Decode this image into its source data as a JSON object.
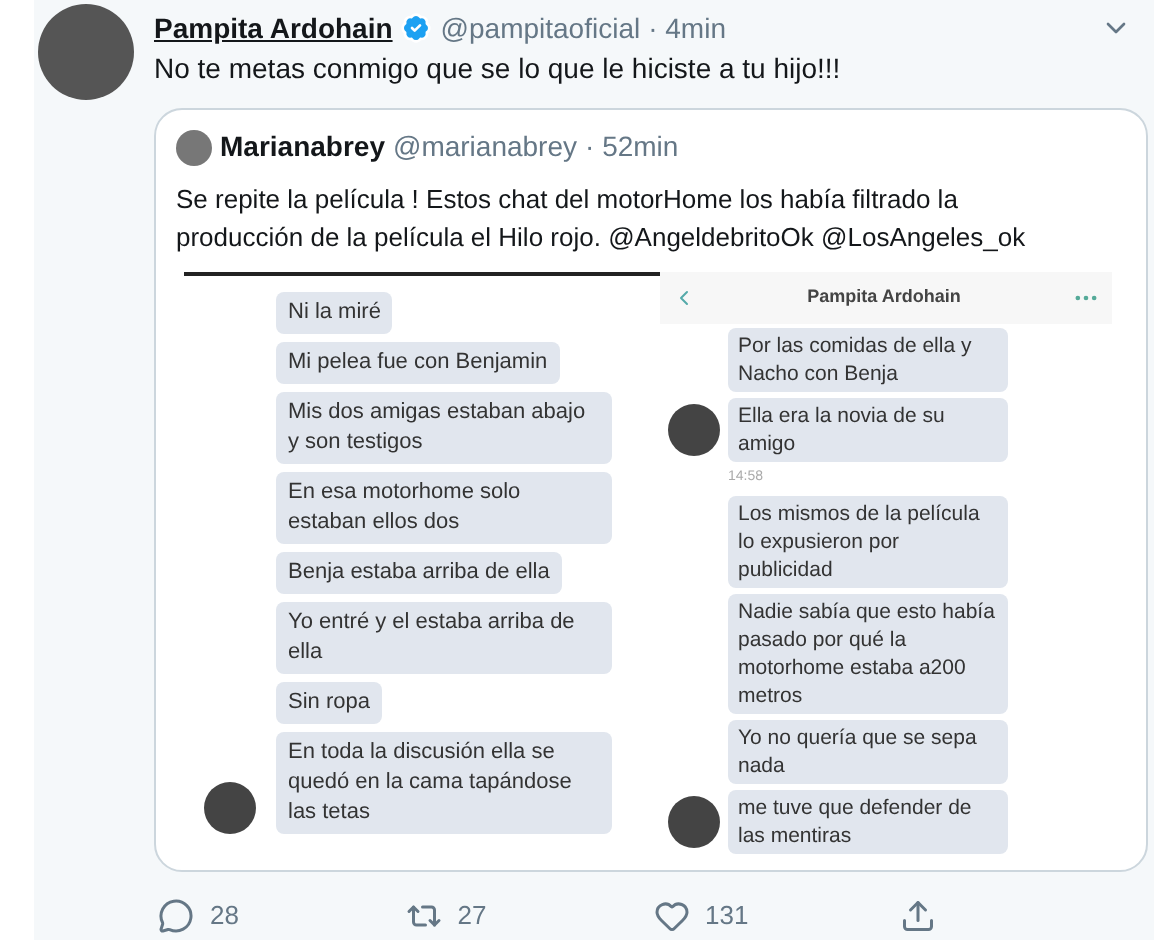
{
  "tweet": {
    "author_name": "Pampita Ardohain",
    "verified": true,
    "handle": "@pampitaoficial",
    "time": "· 4min",
    "text": "No te metas conmigo que se lo que le hiciste a tu hijo!!!",
    "quote": {
      "author_name": "Marianabrey",
      "handle": "@marianabrey",
      "time": "· 52min",
      "text": "Se repite la película ! Estos chat del motorHome los había filtrado la producción de la película el Hilo rojo.",
      "mentions": [
        "@AngeldebritoOk",
        "@LosAngeles_ok"
      ],
      "chat_image": {
        "left_messages": [
          {
            "text": "Ni la miré",
            "avatar": false
          },
          {
            "text": "Mi pelea fue con Benjamin",
            "avatar": false
          },
          {
            "text": "Mis dos amigas estaban abajo y son testigos",
            "avatar": false
          },
          {
            "text": "En esa motorhome solo estaban ellos dos",
            "avatar": false
          },
          {
            "text": "Benja estaba arriba de ella",
            "avatar": false
          },
          {
            "text": "Yo entré y el estaba arriba de ella",
            "avatar": false
          },
          {
            "text": "Sin ropa",
            "avatar": false
          },
          {
            "text": "En toda la discusión ella se quedó en la cama tapándose las tetas",
            "avatar": true
          }
        ],
        "right_title": "Pampita Ardohain",
        "right_messages": [
          {
            "kind": "bubble",
            "text": "Por las comidas de ella y Nacho con Benja",
            "avatar": false
          },
          {
            "kind": "bubble",
            "text": "Ella era la novia de su amigo",
            "avatar": true
          },
          {
            "kind": "time",
            "text": "14:58"
          },
          {
            "kind": "bubble",
            "text": "Los mismos de la película lo expusieron por publicidad",
            "avatar": false
          },
          {
            "kind": "bubble",
            "text": "Nadie sabía que esto había pasado por qué la motorhome estaba a200 metros",
            "avatar": false
          },
          {
            "kind": "bubble",
            "text": "Yo no quería que se sepa nada",
            "avatar": false
          },
          {
            "kind": "bubble",
            "text": "me tuve que defender de las mentiras",
            "avatar": true
          }
        ]
      }
    },
    "actions": [
      {
        "kind": "reply",
        "count": "28"
      },
      {
        "kind": "retweet",
        "count": "27"
      },
      {
        "kind": "like",
        "count": "131"
      },
      {
        "kind": "share"
      }
    ]
  }
}
